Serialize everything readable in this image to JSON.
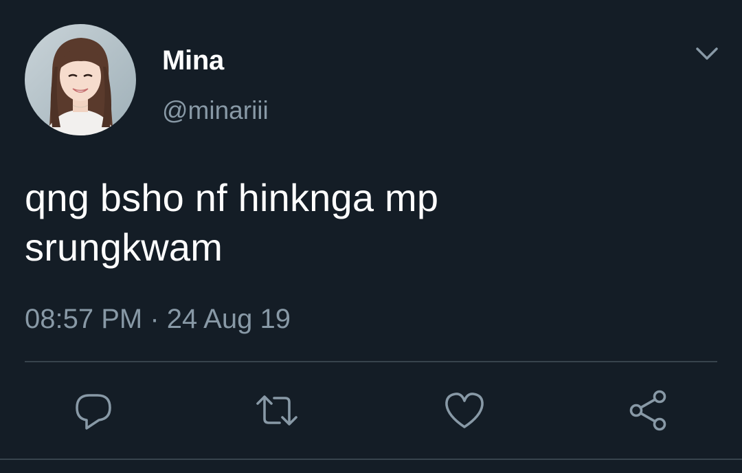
{
  "user": {
    "display_name": "Mina",
    "handle": "@minariii"
  },
  "tweet": {
    "text_lines": [
      "qng bsho nf hinknga mp",
      "srungkwam"
    ],
    "timestamp": "08:57 PM · 24 Aug 19"
  },
  "actions": [
    {
      "name": "reply",
      "icon": "reply-icon"
    },
    {
      "name": "retweet",
      "icon": "retweet-icon"
    },
    {
      "name": "like",
      "icon": "heart-icon"
    },
    {
      "name": "share",
      "icon": "share-icon"
    }
  ],
  "colors": {
    "background": "#141d26",
    "primary_text": "#ffffff",
    "secondary_text": "#8899a6",
    "divider": "#38444d"
  }
}
